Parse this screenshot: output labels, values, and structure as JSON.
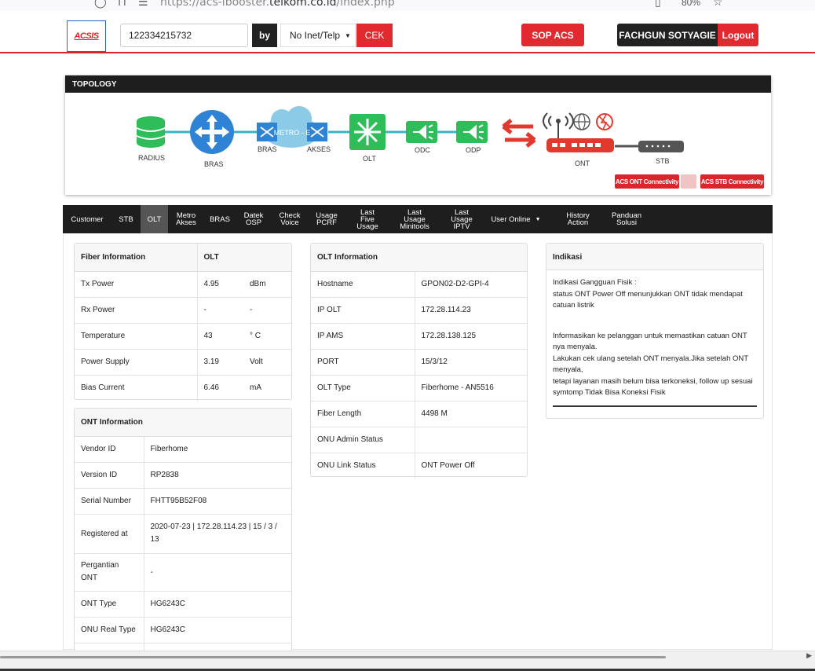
{
  "browser": {
    "url_prefix": "https://acs-ibooster.",
    "url_domain": "telkom.co.id",
    "url_suffix": "/index.php",
    "zoom": "80%"
  },
  "header": {
    "logo_text": "ACSIS",
    "search_value": "122334215732",
    "by_label": "by",
    "select_value": "No Inet/Telp",
    "cek_label": "CEK",
    "sop_label": "SOP ACS",
    "user_name": "FACHGUN SOTYAGIE",
    "logout_label": "Logout"
  },
  "topology": {
    "title": "TOPOLOGY",
    "nodes": {
      "radius": "RADIUS",
      "bras": "BRAS",
      "metro_bras": "BRAS",
      "metro_label": "METRO - E",
      "metro_akses": "AKSES",
      "olt": "OLT",
      "odc": "ODC",
      "odp": "ODP",
      "ont": "ONT",
      "stb": "STB"
    },
    "ont_connectivity_label": "ACS ONT Connectivity",
    "stb_connectivity_label": "ACS STB Connectivity",
    "colors": {
      "green": "#2ebd59",
      "blue": "#2f83d4",
      "red": "#e2392f",
      "dark": "#555555"
    }
  },
  "tabs": [
    {
      "label": "Customer"
    },
    {
      "label": "STB"
    },
    {
      "label": "OLT",
      "active": true
    },
    {
      "label": "Metro Akses"
    },
    {
      "label": "BRAS"
    },
    {
      "label": "Datek OSP"
    },
    {
      "label": "Check Voice"
    },
    {
      "label": "Usage PCRF"
    },
    {
      "label": "Last Five Usage"
    },
    {
      "label": "Last Usage Minitools"
    },
    {
      "label": "Last Usage IPTV"
    },
    {
      "label": "User Online"
    },
    {
      "label": "History Action"
    },
    {
      "label": "Panduan Solusi"
    }
  ],
  "fiber": {
    "header_left": "Fiber Information",
    "header_right": "OLT",
    "rows": [
      {
        "label": "Tx Power",
        "value": "4.95",
        "unit": "dBm"
      },
      {
        "label": "Rx Power",
        "value": "-",
        "unit": "-"
      },
      {
        "label": "Temperature",
        "value": "43",
        "unit": "° C"
      },
      {
        "label": "Power Supply",
        "value": "3.19",
        "unit": "Volt"
      },
      {
        "label": "Bias Current",
        "value": "6.46",
        "unit": "mA"
      }
    ]
  },
  "ont": {
    "header": "ONT Information",
    "rows": [
      {
        "label": "Vendor ID",
        "value": "Fiberhome"
      },
      {
        "label": "Version ID",
        "value": "RP2838"
      },
      {
        "label": "Serial Number",
        "value": "FHTT95B52F08"
      },
      {
        "label": "Registered at",
        "value": "2020-07-23 | 172.28.114.23 | 15 / 3 / 13"
      },
      {
        "label": "Pergantian ONT",
        "value": "-"
      },
      {
        "label": "ONT Type",
        "value": "HG6243C"
      },
      {
        "label": "ONU Real Type",
        "value": "HG6243C"
      }
    ]
  },
  "olt": {
    "header": "OLT Information",
    "rows": [
      {
        "label": "Hostname",
        "value": "GPON02-D2-GPI-4"
      },
      {
        "label": "IP OLT",
        "value": "172.28.114.23"
      },
      {
        "label": "IP AMS",
        "value": "172.28.138.125"
      },
      {
        "label": "PORT",
        "value": "15/3/12"
      },
      {
        "label": "OLT Type",
        "value": "Fiberhome - AN5516"
      },
      {
        "label": "Fiber Length",
        "value": "4498 M"
      },
      {
        "label": "ONU Admin Status",
        "value": ""
      },
      {
        "label": "ONU Link Status",
        "value": "ONT Power Off"
      }
    ]
  },
  "indikasi": {
    "header": "Indikasi",
    "line1": "Indikasi Gangguan Fisik :",
    "line2": "status ONT Power Off menunjukkan ONT tidak mendapat catuan listrik",
    "line3": "Informasikan ke pelanggan untuk memastikan catuan ONT nya menyala.",
    "line4": "Lakukan cek ulang setelah ONT menyala.Jika setelah ONT menyala,",
    "line5": "tetapi layanan masih belum bisa terkoneksi, follow up sesuai symtomp Tidak Bisa Koneksi Fisik"
  }
}
